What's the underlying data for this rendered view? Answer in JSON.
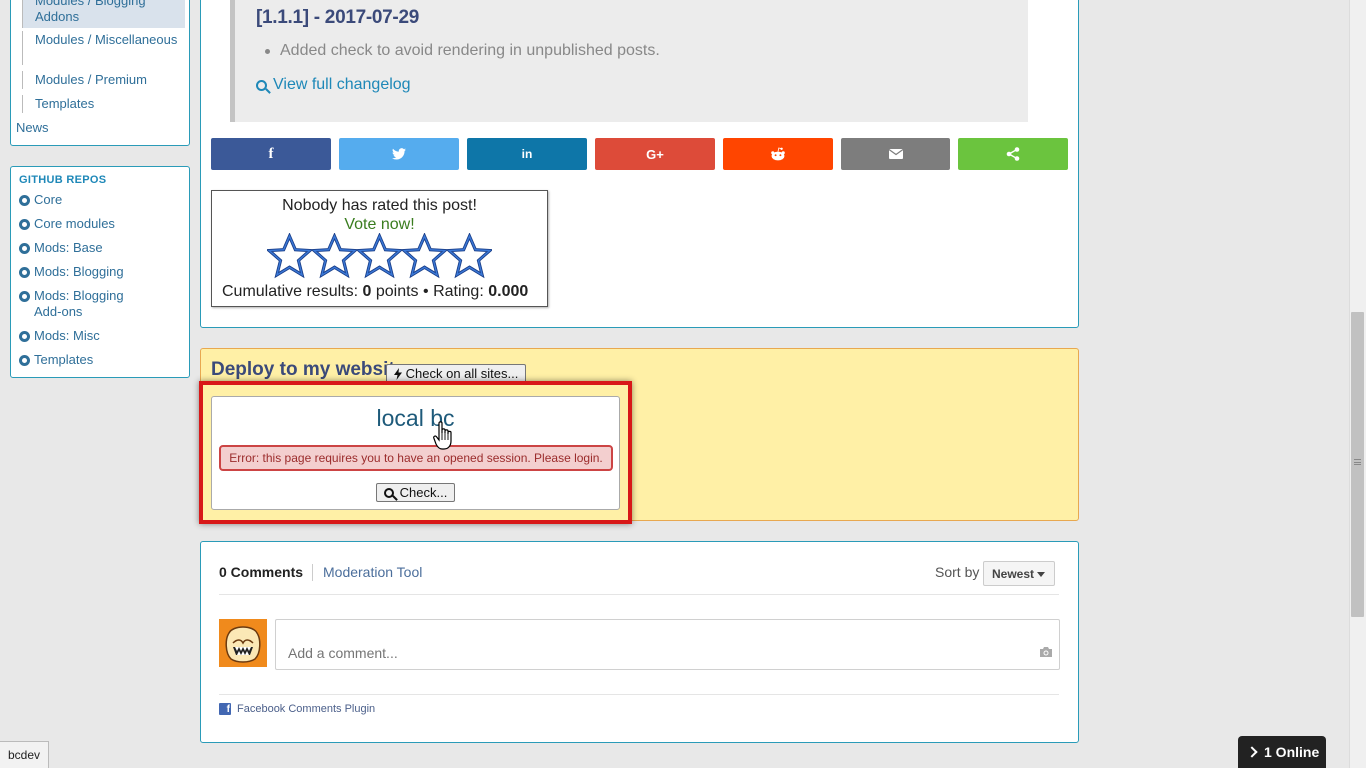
{
  "sidebar": {
    "menu": {
      "items": [
        "Modules / Blogging Addons",
        "Modules / Miscellaneous",
        "Modules / Premium",
        "Templates"
      ],
      "news": "News"
    },
    "repos": {
      "heading": "GITHUB REPOS",
      "items": [
        "Core",
        "Core modules",
        "Mods: Base",
        "Mods: Blogging",
        "Mods: Blogging Add-ons",
        "Mods: Misc",
        "Templates"
      ]
    }
  },
  "changelog": {
    "version": "[1.1.1] - 2017-07-29",
    "item": "Added check to avoid rendering in unpublished posts.",
    "link": "View full changelog"
  },
  "share": {
    "buttons": [
      {
        "name": "facebook",
        "glyph": "f",
        "color": "#3b5998"
      },
      {
        "name": "twitter",
        "glyph": "t",
        "color": "#55acee"
      },
      {
        "name": "linkedin",
        "glyph": "in",
        "color": "#0e76a8"
      },
      {
        "name": "google-plus",
        "glyph": "G+",
        "color": "#dd4b39"
      },
      {
        "name": "reddit",
        "glyph": "r",
        "color": "#ff4500"
      },
      {
        "name": "email",
        "glyph": "mail",
        "color": "#7d7d7d"
      },
      {
        "name": "sharethis",
        "glyph": "share",
        "color": "#6bc43e"
      }
    ]
  },
  "rating": {
    "headline": "Nobody has rated this post!",
    "vote": "Vote now!",
    "results_label": "Cumulative results:",
    "points_value": "0",
    "points_label": "points",
    "separator": "•",
    "rating_label": "Rating:",
    "rating_value": "0.000",
    "stars_filled": 0,
    "stars_total": 5
  },
  "deploy": {
    "title": "Deploy to my websites",
    "check_all_label": "Check on all sites...",
    "site": {
      "name": "local bc",
      "error": "Error: this page requires you to have an opened session. Please login.",
      "check_label": "Check..."
    }
  },
  "comments": {
    "count_label": "0 Comments",
    "moderation": "Moderation Tool",
    "sort_by": "Sort by",
    "sort_value": "Newest",
    "placeholder": "Add a comment...",
    "plugin": "Facebook Comments Plugin"
  },
  "status": {
    "url": "bcdev",
    "online": "1 Online"
  },
  "colors": {
    "accent": "#2a9bb8",
    "deploy_bg": "#fff0a6",
    "error_border": "#cc4444",
    "highlight": "#d81818"
  }
}
